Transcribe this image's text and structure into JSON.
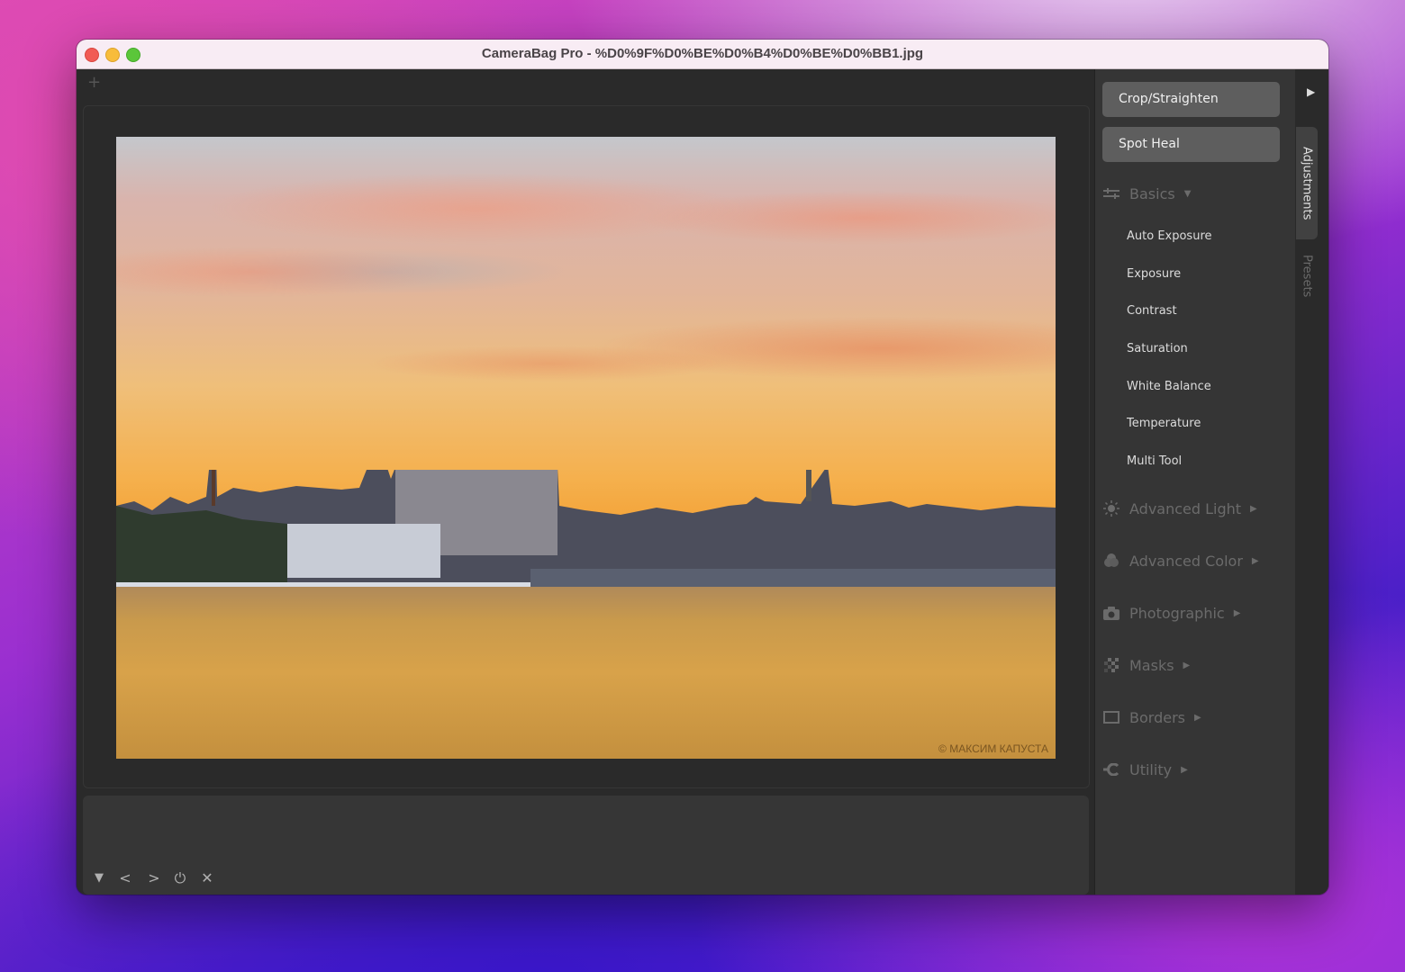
{
  "window": {
    "title": "CameraBag Pro - %D0%9F%D0%BE%D0%B4%D0%BE%D0%BB1.jpg"
  },
  "toolbar": {
    "add_label": "+"
  },
  "photo": {
    "watermark": "© МАКСИМ КАПУСТА",
    "description": "sunset over river with city skyline"
  },
  "filmstrip": {
    "buttons": [
      {
        "name": "collapse",
        "glyph": "▼"
      },
      {
        "name": "previous",
        "glyph": "<"
      },
      {
        "name": "next",
        "glyph": ">"
      },
      {
        "name": "power",
        "glyph": "⏻"
      },
      {
        "name": "close",
        "glyph": "✕"
      }
    ]
  },
  "panel": {
    "tool_buttons": [
      "Crop/Straighten",
      "Spot Heal"
    ],
    "basics": {
      "label": "Basics",
      "expanded": true,
      "items": [
        "Auto Exposure",
        "Exposure",
        "Contrast",
        "Saturation",
        "White Balance",
        "Temperature",
        "Multi Tool"
      ]
    },
    "sections": [
      {
        "label": "Advanced Light",
        "icon": "sun-icon"
      },
      {
        "label": "Advanced Color",
        "icon": "color-circles-icon"
      },
      {
        "label": "Photographic",
        "icon": "camera-icon"
      },
      {
        "label": "Masks",
        "icon": "checker-mask-icon"
      },
      {
        "label": "Borders",
        "icon": "border-rect-icon"
      },
      {
        "label": "Utility",
        "icon": "utility-icon"
      }
    ]
  },
  "tabs": {
    "collapse_glyph": "▶",
    "items": [
      {
        "label": "Adjustments",
        "active": true
      },
      {
        "label": "Presets",
        "active": false
      }
    ]
  }
}
